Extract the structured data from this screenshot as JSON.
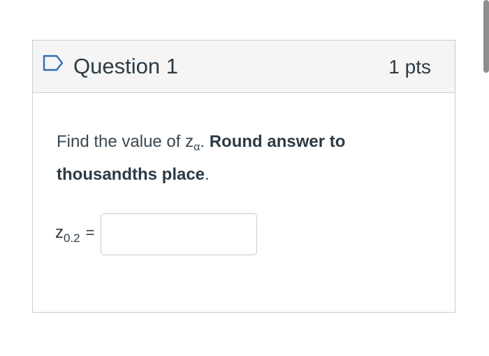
{
  "question": {
    "title": "Question 1",
    "points": "1 pts",
    "prompt": {
      "lead": "Find the value of ",
      "variable": "z",
      "subscript": "α",
      "period": ". ",
      "bold_tail": "Round answer to thousandths place",
      "end": "."
    },
    "answer": {
      "label_var": "z",
      "label_sub": "0.2",
      "equals": "=",
      "value": "",
      "placeholder": ""
    }
  },
  "colors": {
    "text": "#2d3b45",
    "border": "#c7cdd1",
    "header_bg": "#f5f5f5",
    "flag": "#2f6fb5"
  },
  "icons": {
    "flag": "bookmark-flag-icon"
  }
}
